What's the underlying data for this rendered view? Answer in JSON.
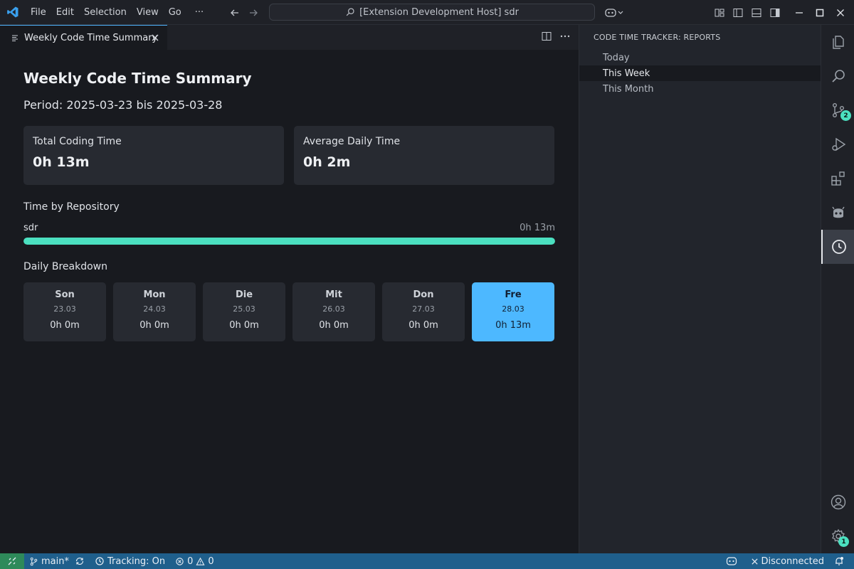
{
  "titlebar": {
    "menu": [
      "File",
      "Edit",
      "Selection",
      "View",
      "Go",
      "···"
    ],
    "command_center": "[Extension Development Host] sdr"
  },
  "editor": {
    "tab_label": "Weekly Code Time Summary",
    "heading": "Weekly Code Time Summary",
    "period": "Period: 2025-03-23 bis 2025-03-28",
    "cards": [
      {
        "label": "Total Coding Time",
        "value": "0h 13m"
      },
      {
        "label": "Average Daily Time",
        "value": "0h 2m"
      }
    ],
    "repo_section_title": "Time by Repository",
    "repos": [
      {
        "name": "sdr",
        "time": "0h 13m",
        "fraction": 1.0
      }
    ],
    "daily_section_title": "Daily Breakdown",
    "days": [
      {
        "name": "Son",
        "date": "23.03",
        "time": "0h 0m",
        "active": false
      },
      {
        "name": "Mon",
        "date": "24.03",
        "time": "0h 0m",
        "active": false
      },
      {
        "name": "Die",
        "date": "25.03",
        "time": "0h 0m",
        "active": false
      },
      {
        "name": "Mit",
        "date": "26.03",
        "time": "0h 0m",
        "active": false
      },
      {
        "name": "Don",
        "date": "27.03",
        "time": "0h 0m",
        "active": false
      },
      {
        "name": "Fre",
        "date": "28.03",
        "time": "0h 13m",
        "active": true
      }
    ]
  },
  "sidebar": {
    "title": "CODE TIME TRACKER: REPORTS",
    "items": [
      {
        "label": "Today",
        "selected": false
      },
      {
        "label": "This Week",
        "selected": true
      },
      {
        "label": "This Month",
        "selected": false
      }
    ]
  },
  "activity_bar": {
    "source_control_badge": "2",
    "settings_badge": "1"
  },
  "statusbar": {
    "branch": "main*",
    "tracking": "Tracking: On",
    "errors": "0",
    "warnings": "0",
    "connection": "Disconnected"
  },
  "colors": {
    "accent": "#4db8ff",
    "bar_fill": "#4be0c0",
    "statusbar": "#1f5f8c",
    "remote": "#2e8a5a"
  }
}
